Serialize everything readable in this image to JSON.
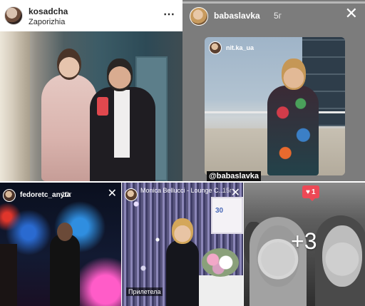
{
  "post": {
    "username": "kosadcha",
    "location": "Zaporizhia",
    "more_icon": "⋯"
  },
  "story1": {
    "username": "babaslavka",
    "time": "5г",
    "close": "✕",
    "inner_username": "nit.ka_ua",
    "mention": "@babaslavka"
  },
  "story2": {
    "username": "fedoretc_anyta",
    "time": "10г",
    "close": "✕"
  },
  "story3": {
    "username": "Monica Bellucci - Lounge C...",
    "subtitle": "",
    "time": "15г",
    "close": "✕",
    "caption": "Прилетела",
    "frame_text": "30"
  },
  "selfie": {
    "like_count": "1",
    "more_count": "+3"
  },
  "colors": {
    "like_badge": "#ed4956",
    "story_text": "#ffffff",
    "post_text": "#262626"
  }
}
